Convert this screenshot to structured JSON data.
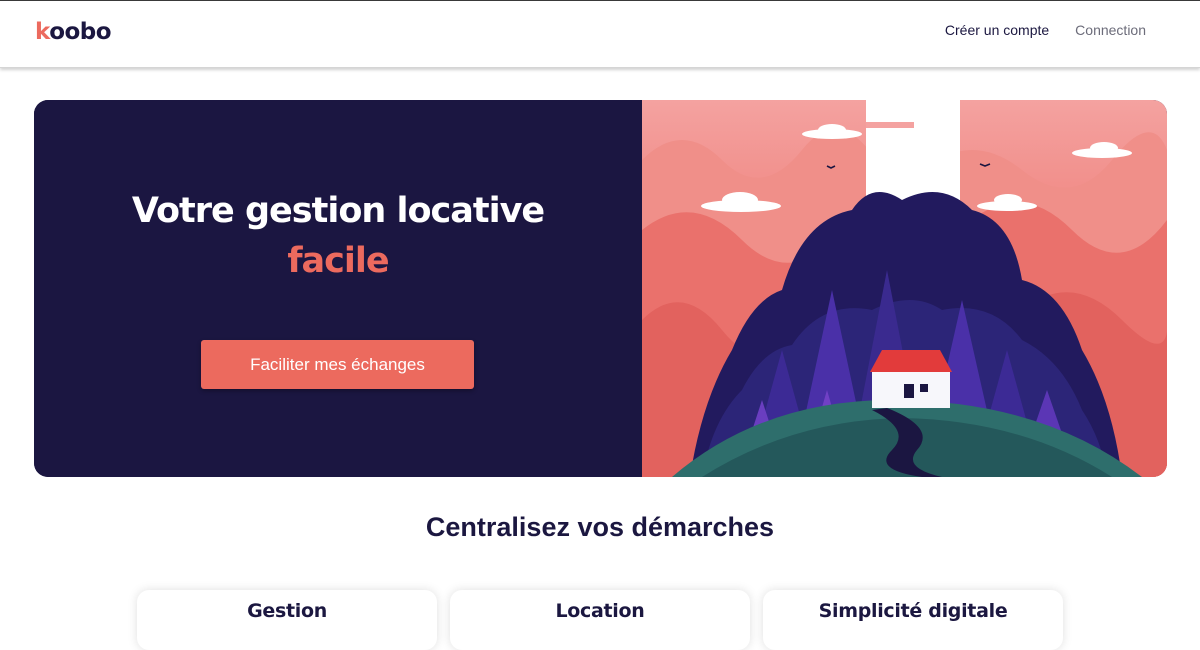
{
  "header": {
    "logo_first": "k",
    "logo_rest": "oobo",
    "nav": {
      "signup_label": "Créer un compte",
      "login_label": "Connection"
    }
  },
  "hero": {
    "title_line1": "Votre gestion locative",
    "title_accent": "facile",
    "cta_label": "Faciliter mes échanges",
    "illustration": "forest-house-illustration"
  },
  "section": {
    "title": "Centralisez vos démarches",
    "cards": [
      {
        "title": "Gestion"
      },
      {
        "title": "Location"
      },
      {
        "title": "Simplicité digitale"
      }
    ]
  },
  "colors": {
    "brand_navy": "#1b1641",
    "brand_coral": "#ec6a5e",
    "text_dark": "#1b1740",
    "nav_muted": "#6c6c7a"
  },
  "icons": [
    "house-icon",
    "bird-icon",
    "cloud-icon",
    "tree-icon"
  ]
}
